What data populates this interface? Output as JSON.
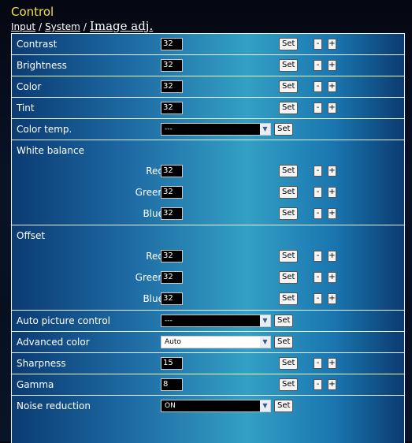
{
  "header": {
    "title": "Control",
    "breadcrumb": {
      "input": "Input",
      "system": "System",
      "current": "Image adj.",
      "separator": "/"
    }
  },
  "controls": {
    "set_label": "Set",
    "minus_label": "-",
    "plus_label": "+",
    "contrast": {
      "label": "Contrast",
      "value": "32"
    },
    "brightness": {
      "label": "Brightness",
      "value": "32"
    },
    "color": {
      "label": "Color",
      "value": "32"
    },
    "tint": {
      "label": "Tint",
      "value": "32"
    },
    "color_temp": {
      "label": "Color temp.",
      "value": "---"
    },
    "white_balance": {
      "label": "White balance",
      "red": {
        "label": "Red",
        "value": "32"
      },
      "green": {
        "label": "Green",
        "value": "32"
      },
      "blue": {
        "label": "Blue",
        "value": "32"
      }
    },
    "offset": {
      "label": "Offset",
      "red": {
        "label": "Red",
        "value": "32"
      },
      "green": {
        "label": "Green",
        "value": "32"
      },
      "blue": {
        "label": "Blue",
        "value": "32"
      }
    },
    "auto_picture": {
      "label": "Auto picture control",
      "value": "---"
    },
    "advanced_color": {
      "label": "Advanced color",
      "value": "Auto"
    },
    "sharpness": {
      "label": "Sharpness",
      "value": "15"
    },
    "gamma": {
      "label": "Gamma",
      "value": "8"
    },
    "noise_reduction": {
      "label": "Noise reduction",
      "value": "ON"
    }
  }
}
